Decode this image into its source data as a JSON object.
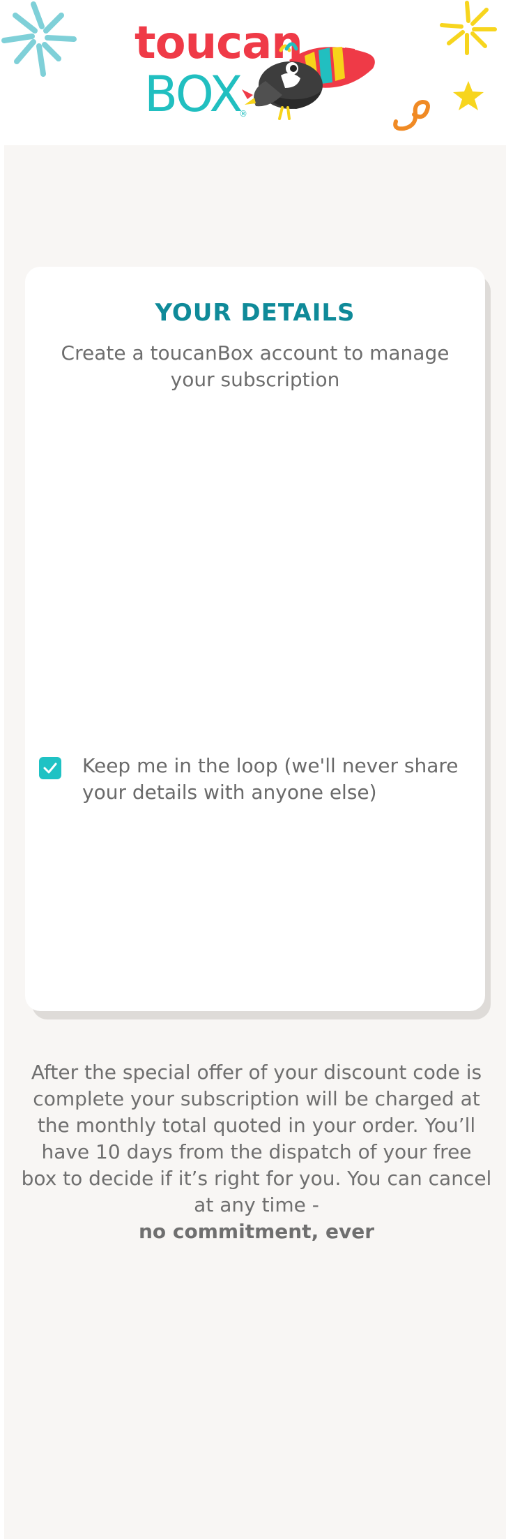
{
  "header": {
    "logo": {
      "word_top": "toucan",
      "word_bottom": "BOX",
      "registered_mark": "®",
      "brand_colors": {
        "red": "#ef3a47",
        "teal": "#21bfc0",
        "yellow": "#f7d31a",
        "orange": "#f08a24"
      }
    },
    "decorations": [
      "teal-burst-icon",
      "yellow-burst-icon",
      "yellow-star-icon",
      "orange-swirl-icon"
    ]
  },
  "card": {
    "title": "YOUR DETAILS",
    "subtitle": "Create a toucanBox account to manage your subscription",
    "newsletter_checkbox": {
      "checked": true,
      "label": "Keep me in the loop (we'll never share your details with anyone else)",
      "accent_color": "#1fc2c4"
    }
  },
  "disclaimer": {
    "text": "After the special offer of your discount code is complete your subscription will be charged at the monthly total quoted in your order. You’ll have 10 days from the dispatch of your free box to decide if it’s right for you. You can cancel at any time -",
    "emphasis": "no commitment, ever"
  },
  "colors": {
    "title_teal": "#0f8a99",
    "page_background": "#f8f6f4",
    "card_background": "#ffffff"
  }
}
